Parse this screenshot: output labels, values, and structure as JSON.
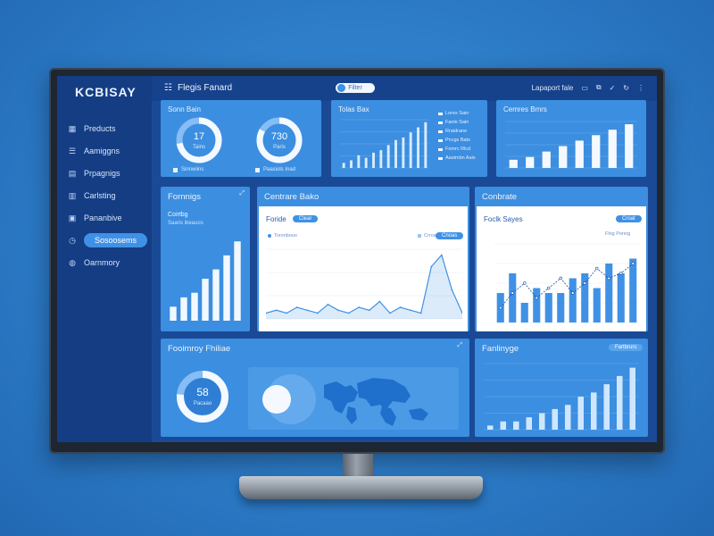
{
  "sidebar": {
    "brand": "KCBISAY",
    "items": [
      {
        "label": "Preducts",
        "icon": "grid-icon"
      },
      {
        "label": "Aamiggns",
        "icon": "list-icon"
      },
      {
        "label": "Prpagnigs",
        "icon": "layers-icon"
      },
      {
        "label": "Carlsting",
        "icon": "chart-icon"
      },
      {
        "label": "Pananbive",
        "icon": "calendar-icon"
      },
      {
        "label": "Sosoosems",
        "icon": "clock-icon",
        "active": true
      },
      {
        "label": "Oarnmory",
        "icon": "globe-icon"
      }
    ]
  },
  "header": {
    "title": "Flegis Fanard",
    "toggle_label": "Filter",
    "right_label": "Lapaport fale"
  },
  "cards": {
    "kpi": {
      "title": "Sonn Bain",
      "ring1_value": "17",
      "ring1_caption": "Tains",
      "ring1_legend": "Sinnwiins",
      "ring2_value": "730",
      "ring2_caption": "Paris",
      "ring2_legend": "Paasiols Inad"
    },
    "sparkline": {
      "title": "Tolas Bax",
      "legend": [
        "Lores Sain",
        "Fanle Sain",
        "Rraidrane",
        "Pncgs Bats",
        "Fomrc Rlcd",
        "Aastmbn Aais"
      ]
    },
    "top_right": {
      "title": "Cemres Bmrs"
    },
    "bar_left": {
      "title": "Fornnigs",
      "subtitle": "Coirtbg",
      "caption": "Saaris ibeauos"
    },
    "line_chart": {
      "card_title": "Centrare Bako",
      "panel_title": "Foride",
      "pill": "Clear",
      "legend_left": "Toronbouo",
      "legend_right": "Crroas",
      "pill2": "Cnoas"
    },
    "bars_right": {
      "card_title": "Conbrate",
      "panel_title": "Foclk Sayes",
      "pill": "Croat",
      "legend": "Fhig Ponng"
    },
    "bottom_left": {
      "title": "Fooimroy Fhiliae",
      "ring_value": "58",
      "ring_caption": "Pacaao"
    },
    "bottom_right": {
      "title": "Fanlinyge",
      "pill": "Fartbrurs"
    }
  },
  "chart_data": [
    {
      "type": "bar",
      "title": "Fornnigs",
      "values": [
        3,
        5,
        6,
        9,
        11,
        14,
        17
      ]
    },
    {
      "type": "line",
      "title": "Foride",
      "values": [
        2,
        3,
        2,
        4,
        3,
        2,
        5,
        3,
        2,
        4,
        3,
        6,
        2,
        4,
        3,
        2,
        18,
        22,
        10,
        2
      ]
    },
    {
      "type": "bar",
      "title": "Foclk Sayes",
      "series": [
        {
          "values": [
            6,
            10,
            4,
            7,
            6,
            6,
            9,
            10,
            7,
            12,
            10,
            13
          ]
        },
        {
          "values": [
            3,
            6,
            8,
            5,
            7,
            9,
            6,
            8,
            11,
            9,
            10,
            12
          ]
        }
      ],
      "ylim": [
        0,
        16
      ]
    },
    {
      "type": "bar",
      "title": "Fanlinyge",
      "values": [
        1,
        2,
        2,
        3,
        4,
        5,
        6,
        8,
        9,
        11,
        13,
        15
      ]
    },
    {
      "type": "bar",
      "title": "Cemres Bmrs",
      "values": [
        3,
        4,
        6,
        8,
        10,
        12,
        14,
        16
      ]
    },
    {
      "type": "bar",
      "title": "Tolas Bax",
      "values": [
        2,
        3,
        5,
        4,
        6,
        7,
        9,
        11,
        12,
        14,
        16,
        18
      ]
    }
  ],
  "colors": {
    "accent": "#3f91e6",
    "panel": "#3c8ee0",
    "sidebar": "#153d84"
  }
}
